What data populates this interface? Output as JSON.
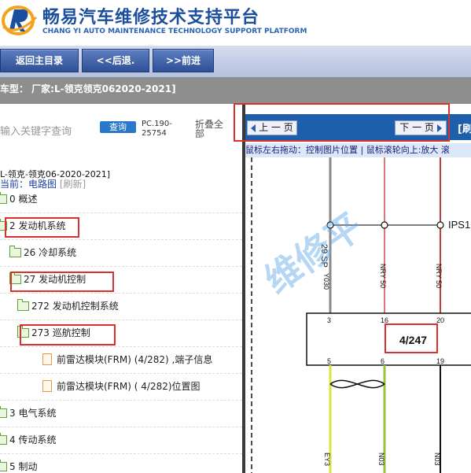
{
  "header": {
    "title_cn": "畅易汽车维修技术支持平台",
    "title_en": "CHANG YI AUTO MAINTENANCE TECHNOLOGY SUPPORT PLATFORM"
  },
  "nav": {
    "home": "返回主目录",
    "back": "<<后退.",
    "forward": ">>前进"
  },
  "model": {
    "text": "车型：  厂家:L-领克领克062020-2021]"
  },
  "search": {
    "placeholder": "输入关键字查询",
    "button": "查询",
    "code": "PC.190-25754",
    "collapse": "折叠全部"
  },
  "breadcrumb": "L-领克-领克06-2020-2021]",
  "current": {
    "label": "当前：电路图",
    "refresh": "[刷新]"
  },
  "tree": [
    {
      "label": "0 概述",
      "type": "folder"
    },
    {
      "label": "2 发动机系统",
      "type": "folder"
    },
    {
      "label": "26 冷却系统",
      "type": "folder"
    },
    {
      "label": "27 发动机控制",
      "type": "folder"
    },
    {
      "label": "272 发动机控制系统",
      "type": "folder"
    },
    {
      "label": "273 巡航控制",
      "type": "folder"
    },
    {
      "label": "前雷达模块(FRM) (4/282) ,端子信息",
      "type": "doc"
    },
    {
      "label": "前雷达模块(FRM) ( 4/282)位置图",
      "type": "doc"
    },
    {
      "label": "3 电气系统",
      "type": "folder"
    },
    {
      "label": "4 传动系统",
      "type": "folder"
    },
    {
      "label": "5 制动",
      "type": "folder"
    }
  ],
  "pager": {
    "prev": "上 一 页",
    "next": "下 一 页",
    "refresh": "[刷"
  },
  "hint": "鼠标左右拖动：控制图片位置 | 鼠标滚轮向上:放大  滚",
  "diagram": {
    "watermark": "维修平",
    "connector_id": "4/247",
    "pins_top": [
      "3",
      "16",
      "20"
    ],
    "pins_bottom": [
      "5",
      "6",
      "19"
    ],
    "wire_top_labels": [
      "29 SP",
      "Y030",
      "NRY 50",
      "NRY 50"
    ],
    "node_label": "IPS1",
    "wire_bottom_labels": [
      "EY3",
      "N03",
      "N03"
    ]
  }
}
